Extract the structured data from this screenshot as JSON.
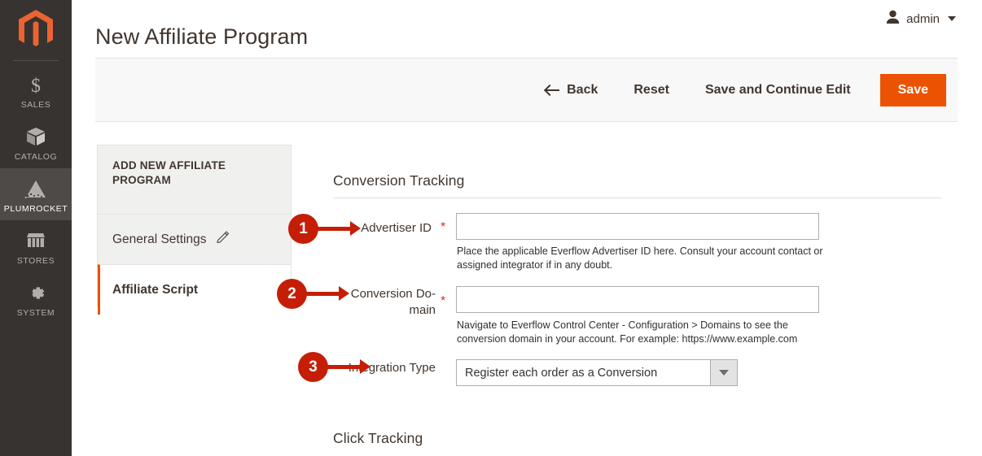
{
  "rail": {
    "logo_icon": "magento-logo-icon",
    "items": [
      {
        "label": "SALES",
        "icon": "dollar-icon",
        "active": false
      },
      {
        "label": "CATALOG",
        "icon": "box-icon",
        "active": false
      },
      {
        "label": "PLUMROCKET",
        "icon": "plumrocket-icon",
        "active": true
      },
      {
        "label": "STORES",
        "icon": "storefront-icon",
        "active": false
      },
      {
        "label": "SYSTEM",
        "icon": "gear-icon",
        "active": false
      }
    ]
  },
  "header": {
    "title": "New Affiliate Program",
    "user": "admin",
    "user_icon": "user-avatar-icon",
    "caret_icon": "chevron-down-icon"
  },
  "toolbar": {
    "back_label": "Back",
    "back_icon": "arrow-left-icon",
    "reset_label": "Reset",
    "save_continue_label": "Save and Continue Edit",
    "save_label": "Save",
    "primary_color": "#eb5202"
  },
  "panel": {
    "title": "ADD NEW AFFILIATE PROGRAM",
    "items": [
      {
        "label": "General Settings",
        "icon": "pencil-edit-icon",
        "current": false
      },
      {
        "label": "Affiliate Script",
        "icon": "",
        "current": true
      }
    ]
  },
  "form": {
    "sections": {
      "conversion_tracking": "Conversion Tracking",
      "click_tracking": "Click Tracking"
    },
    "fields": [
      {
        "label": "Advertiser ID",
        "required": true,
        "value": "",
        "note": "Place the applicable Everflow Advertiser ID here. Consult your account contact or assigned integrator if in any doubt."
      },
      {
        "label": "Conversion Do-main",
        "required": true,
        "value": "",
        "note": "Navigate to Everflow Control Center - Configuration > Domains to see the conversion domain in your account. For example: https://www.example.com"
      },
      {
        "label": "Integration Type",
        "required": false,
        "value": "Register each order as a Conversion",
        "note": ""
      }
    ]
  },
  "callouts": [
    {
      "number": "1",
      "color": "#c51e07"
    },
    {
      "number": "2",
      "color": "#c51e07"
    },
    {
      "number": "3",
      "color": "#c51e07"
    }
  ]
}
